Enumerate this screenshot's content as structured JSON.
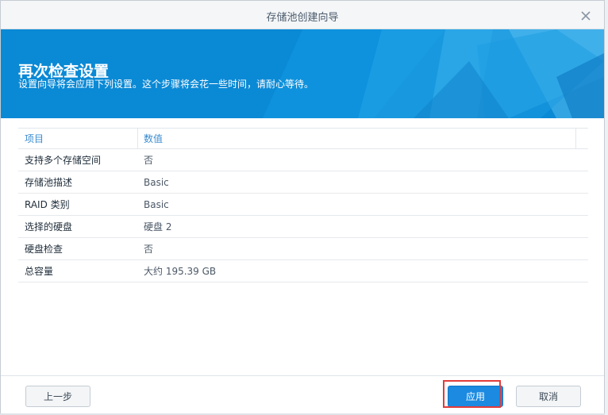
{
  "window": {
    "title": "存储池创建向导"
  },
  "banner": {
    "heading": "再次检查设置",
    "subtitle": "设置向导将会应用下列设置。这个步骤将会花一些时间，请耐心等待。"
  },
  "table": {
    "headers": [
      "项目",
      "数值"
    ],
    "rows": [
      {
        "item": "支持多个存储空间",
        "value": "否"
      },
      {
        "item": "存储池描述",
        "value": "Basic"
      },
      {
        "item": "RAID 类别",
        "value": "Basic"
      },
      {
        "item": "选择的硬盘",
        "value": "硬盘 2"
      },
      {
        "item": "硬盘检查",
        "value": "否"
      },
      {
        "item": "总容量",
        "value": "大约 195.39 GB"
      }
    ]
  },
  "footer": {
    "prev_label": "上一步",
    "apply_label": "应用",
    "cancel_label": "取消"
  },
  "icons": {
    "close": "close-icon"
  },
  "colors": {
    "accent": "#1b8ae0",
    "banner": "#0a8ad6",
    "highlight": "#e23b3b"
  }
}
